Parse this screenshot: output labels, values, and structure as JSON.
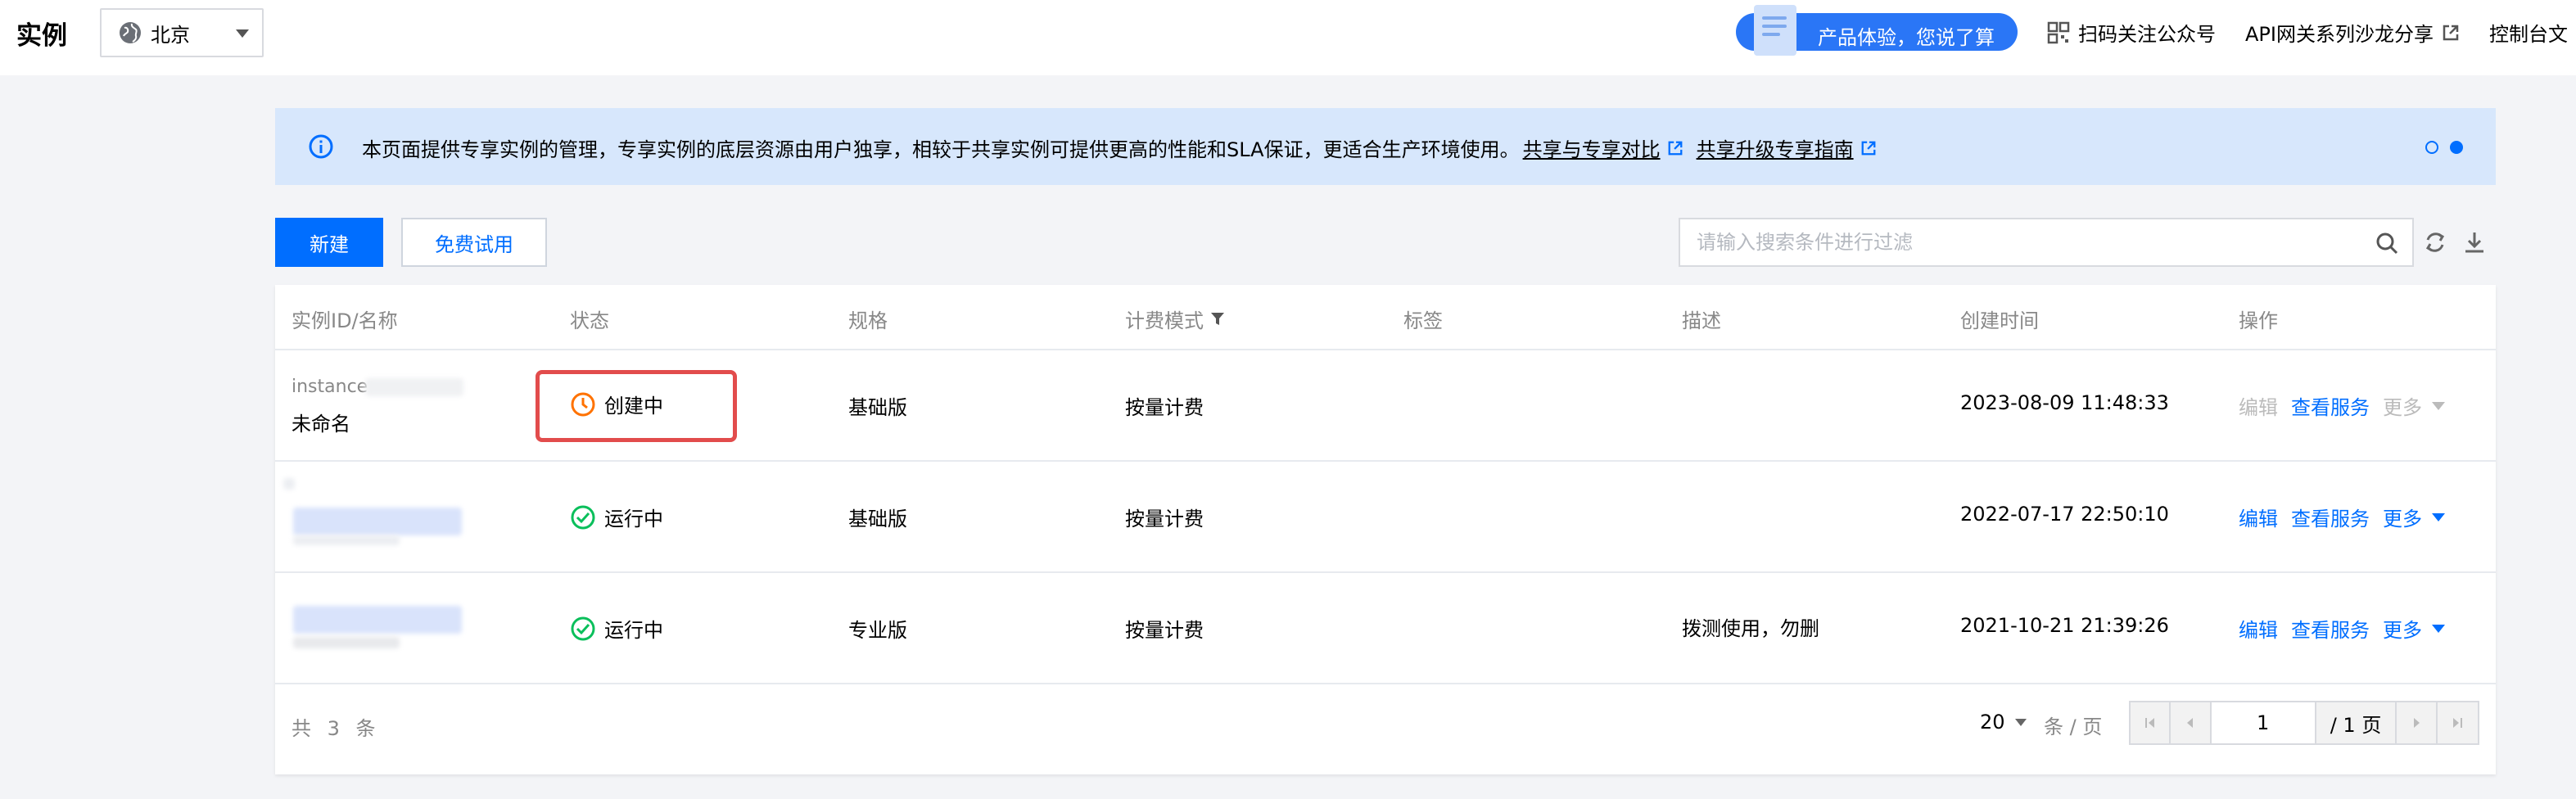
{
  "header": {
    "title": "实例",
    "region": "北京",
    "feedback": "产品体验，您说了算",
    "qr_link": "扫码关注公众号",
    "share_link": "API网关系列沙龙分享",
    "console_link": "控制台文"
  },
  "notice": {
    "text": "本页面提供专享实例的管理，专享实例的底层资源由用户独享，相较于共享实例可提供更高的性能和SLA保证，更适合生产环境使用。",
    "link1": "共享与专享对比",
    "link2": "共享升级专享指南"
  },
  "toolbar": {
    "new_label": "新建",
    "trial_label": "免费试用",
    "search_placeholder": "请输入搜索条件进行过滤"
  },
  "table": {
    "columns": [
      "实例ID/名称",
      "状态",
      "规格",
      "计费模式",
      "标签",
      "描述",
      "创建时间",
      "操作"
    ],
    "rows": [
      {
        "id": "instance",
        "name": "未命名",
        "status": "创建中",
        "spec": "基础版",
        "billing": "按量计费",
        "tags": "",
        "desc": "",
        "created": "2023-08-09 11:48:33",
        "op_edit": "编辑",
        "op_view": "查看服务",
        "op_more": "更多"
      },
      {
        "id": "",
        "name": "",
        "status": "运行中",
        "spec": "基础版",
        "billing": "按量计费",
        "tags": "",
        "desc": "",
        "created": "2022-07-17 22:50:10",
        "op_edit": "编辑",
        "op_view": "查看服务",
        "op_more": "更多"
      },
      {
        "id": "",
        "name": "",
        "status": "运行中",
        "spec": "专业版",
        "billing": "按量计费",
        "tags": "",
        "desc": "拨测使用，勿删",
        "created": "2021-10-21 21:39:26",
        "op_edit": "编辑",
        "op_view": "查看服务",
        "op_more": "更多"
      }
    ]
  },
  "footer": {
    "total": "共 3 条",
    "page_size": "20",
    "page_size_unit": "条 / 页",
    "current_page": "1",
    "total_pages": "/ 1 页"
  },
  "colors": {
    "primary": "#006eff",
    "status_creating": "#ff7200",
    "status_running": "#0abf5b",
    "highlight": "#e24c4c"
  }
}
